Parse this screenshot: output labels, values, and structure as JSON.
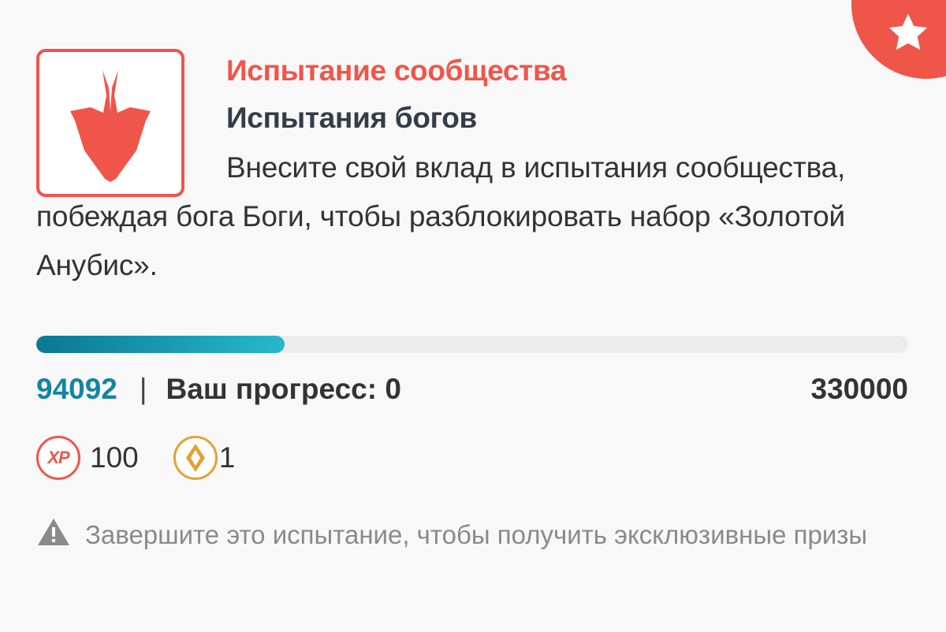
{
  "badge": {
    "icon": "star-icon",
    "color": "#f0554a"
  },
  "challenge": {
    "logo_icon": "flame-blade-icon",
    "type_label": "Испытание сообщества",
    "title": "Испытания богов",
    "description": "Внесите свой вклад в испытания сообщества, побеждая бога Боги, чтобы разблокировать набор «Золотой Анубис»."
  },
  "progress": {
    "current": "94092",
    "separator": "|",
    "your_progress_label": "Ваш прогресс: 0",
    "target": "330000",
    "fraction": 0.2851
  },
  "rewards": [
    {
      "icon": "xp-icon",
      "icon_text": "XP",
      "value": "100"
    },
    {
      "icon": "gem-icon",
      "value": "1"
    }
  ],
  "notice": {
    "icon": "warning-icon",
    "text": "Завершите это испытание, чтобы получить эксклюзивные призы"
  },
  "colors": {
    "accent": "#f0554a",
    "title": "#333d4a",
    "progress_start": "#0a7894",
    "progress_end": "#27b8cc",
    "current_value": "#1385a3",
    "gem": "#e2a233"
  }
}
